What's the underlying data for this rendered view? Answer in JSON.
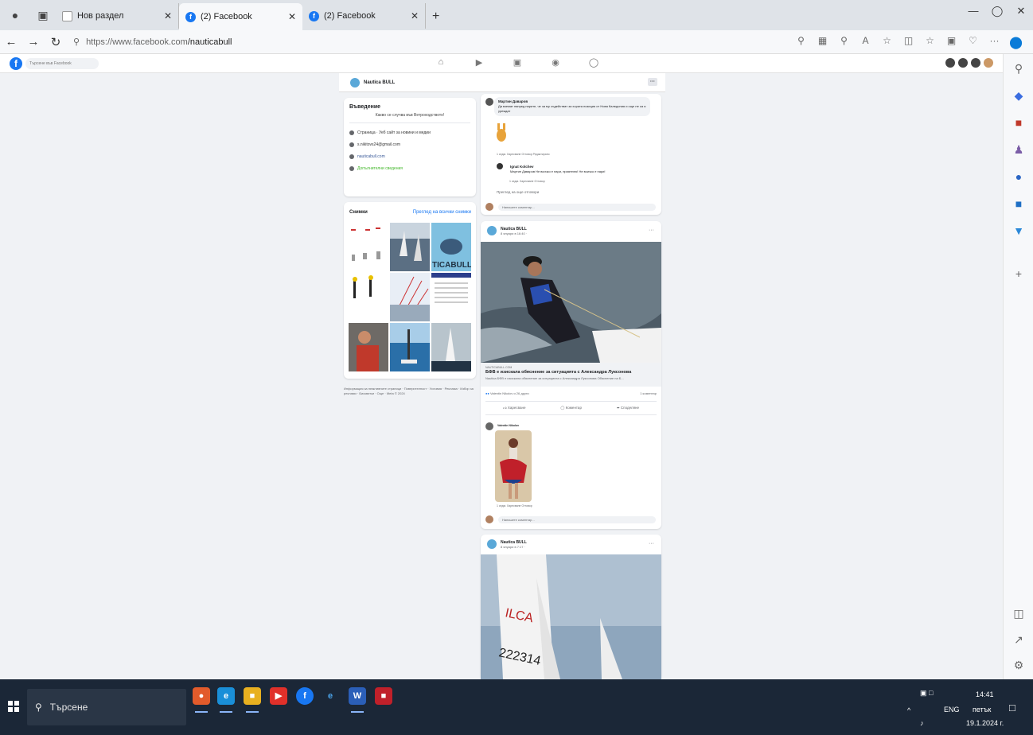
{
  "browser": {
    "tabs": [
      {
        "title": "Нов раздел",
        "icon": "blank-page-icon"
      },
      {
        "title": "(2) Facebook",
        "icon": "facebook-icon",
        "active": true
      },
      {
        "title": "(2) Facebook",
        "icon": "facebook-icon"
      }
    ],
    "url_host": "https://www.facebook.com",
    "url_path": "/nauticabull"
  },
  "facebook": {
    "search_placeholder": "Търсене във Facebook",
    "page_name": "Nautica BULL",
    "intro": {
      "title": "Въведение",
      "tagline": "Каквo се случва във Ветроходството!",
      "rows": [
        "Страница · Уеб сайт за новини и медии",
        "s.nikitovs24@gmail.com",
        "nauticabull.com",
        "Допълнителни сведения"
      ]
    },
    "photos": {
      "title": "Снимки",
      "see_all": "Преглед на всички снимки"
    },
    "footer": "Информация за неактивните страници · Поверителност · Условия · Реклама · Избор за реклами · Бисквитки · Още · Meta © 2024",
    "post1": {
      "comment1_author": "Мартин Даваров",
      "comment1_text": "Да вземат напред парите, че за му съдействат за хората позиция от Нова Каледония и още не са я уреждат",
      "comment1_meta": "1 седм.  Харесване  Отговор  Редактирано",
      "reply_author": "Ignat Kolchev",
      "reply_text": "Мартин Даваров Не всичко е пари, приятелю! Не всичко е пари!",
      "reply_meta": "1 седм.  Харесване  Отговор",
      "more_replies": "Преглед на още отговори",
      "write_comment": "Напишете коментар..."
    },
    "post2": {
      "author": "Nautica BULL",
      "date": "8 януари в 16:40 · ",
      "link_domain": "NAUTICABULL.COM",
      "link_title": "БФВ е изискала обяснение за ситуацията с Александра Луксонова",
      "link_desc": "Nautica БФВ е изискала обяснение за ситуацията с Александра Луксонова Обяснение на Б...",
      "reactions": "Valentin Nikolov и 26 други",
      "comments_count": "1 коментар",
      "like": "Харесване",
      "comment": "Коментар",
      "share": "Споделяне",
      "commenter": "Valentin Nikolov",
      "comment_meta": "1 седм.  Харесване  Отговор",
      "write_comment": "Напишете коментар..."
    },
    "post3": {
      "author": "Nautica BULL",
      "date": "8 януари в 7:17 · ",
      "sail_number": "222314",
      "sail_text": "ILCA"
    }
  },
  "taskbar": {
    "search": "Търсене",
    "lang": "ENG",
    "time": "14:41",
    "day": "петък",
    "date": "19.1.2024 г."
  }
}
